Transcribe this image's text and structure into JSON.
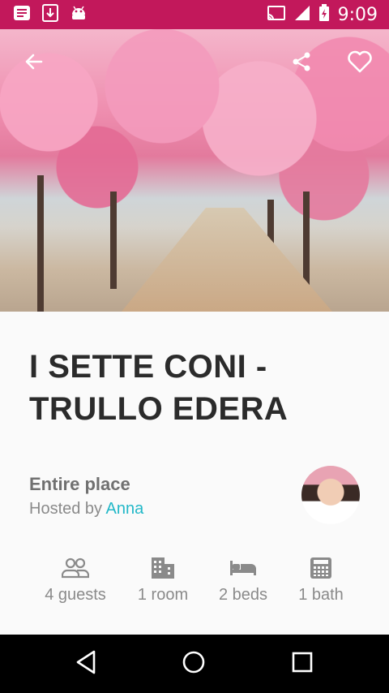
{
  "statusbar": {
    "time": "9:09",
    "bg_color": "#c2185b"
  },
  "listing": {
    "title": "I SETTE CONI - TRULLO EDERA",
    "place_type": "Entire place",
    "hosted_prefix": "Hosted by ",
    "host_name": "Anna",
    "host_color": "#22b8c8"
  },
  "amenities": [
    {
      "icon": "guests-icon",
      "label": "4 guests"
    },
    {
      "icon": "room-icon",
      "label": "1 room"
    },
    {
      "icon": "bed-icon",
      "label": "2 beds"
    },
    {
      "icon": "bath-icon",
      "label": "1 bath"
    }
  ],
  "icons": {
    "back": "back-arrow-icon",
    "share": "share-icon",
    "favorite": "heart-icon",
    "nav_back": "nav-back-icon",
    "nav_home": "nav-home-icon",
    "nav_recents": "nav-recents-icon"
  }
}
